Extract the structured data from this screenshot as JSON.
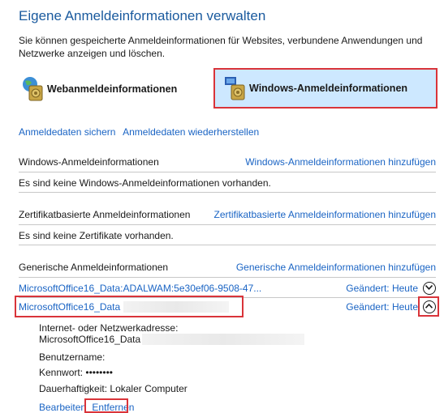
{
  "header": {
    "title": "Eigene Anmeldeinformationen verwalten",
    "description": "Sie können gespeicherte Anmeldeinformationen für Websites, verbundene Anwendungen und Netzwerke anzeigen und löschen."
  },
  "categories": {
    "web_label": "Webanmeldeinformationen",
    "windows_label": "Windows-Anmeldeinformationen"
  },
  "actions": {
    "backup": "Anmeldedaten sichern",
    "restore": "Anmeldedaten wiederherstellen"
  },
  "windows_section": {
    "heading": "Windows-Anmeldeinformationen",
    "add_link": "Windows-Anmeldeinformationen hinzufügen",
    "empty": "Es sind keine Windows-Anmeldeinformationen vorhanden."
  },
  "cert_section": {
    "heading": "Zertifikatbasierte Anmeldeinformationen",
    "add_link": "Zertifikatbasierte Anmeldeinformationen hinzufügen",
    "empty": "Es sind keine Zertifikate vorhanden."
  },
  "generic_section": {
    "heading": "Generische Anmeldeinformationen",
    "add_link": "Generische Anmeldeinformationen hinzufügen",
    "items": [
      {
        "name": "MicrosoftOffice16_Data:ADALWAM:5e30ef06-9508-47...",
        "changed": "Geändert: Heute"
      },
      {
        "name": "MicrosoftOffice16_Data",
        "changed": "Geändert: Heute"
      }
    ],
    "details": {
      "address_label": "Internet- oder Netzwerkadresse:",
      "address_value": "MicrosoftOffice16_Data",
      "username_label": "Benutzername:",
      "password_label": "Kennwort:",
      "password_value": "••••••••",
      "persistence_label": "Dauerhaftigkeit:",
      "persistence_value": "Lokaler Computer",
      "edit": "Bearbeiten",
      "remove": "Entfernen"
    }
  },
  "colors": {
    "link": "#1a64c4",
    "highlight": "#cde8ff",
    "annotation": "#d9343a"
  }
}
